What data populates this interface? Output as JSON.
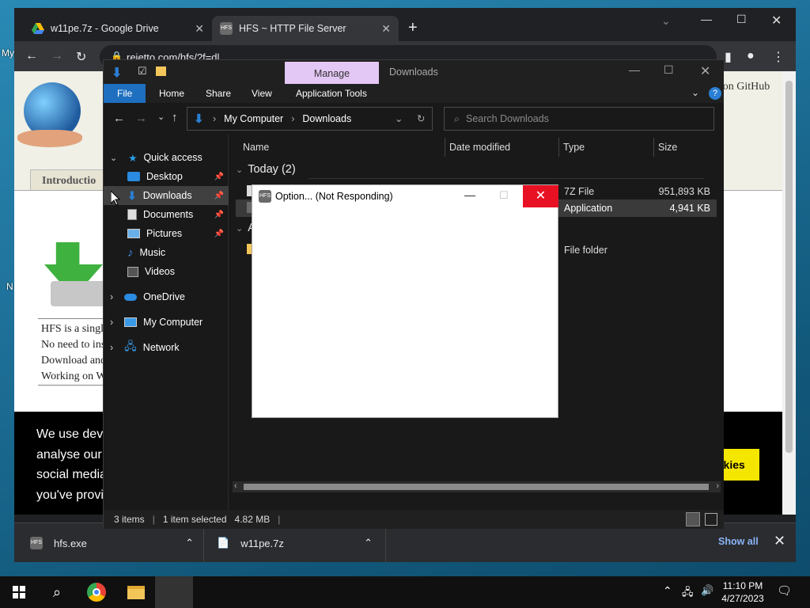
{
  "desktop": {
    "icon_labels": [
      "My",
      "N"
    ]
  },
  "chrome": {
    "tabs": [
      {
        "title": "w11pe.7z - Google Drive",
        "icon": "google-drive-icon"
      },
      {
        "title": "HFS ~ HTTP File Server",
        "icon": "hfs-icon"
      }
    ],
    "url": "rejetto.com/hfs/?f=dl",
    "webpage": {
      "github_text": "e on GitHub",
      "tab_label": "Introductio",
      "desc_lines": [
        "HFS is a singl",
        "No need to ins",
        "Download and",
        "Working on W"
      ],
      "cookie_lines": [
        "We use dev",
        "analyse our",
        "social media",
        "you've provi"
      ],
      "cookie_button": "okies"
    },
    "downloads": [
      {
        "name": "hfs.exe",
        "icon": "hfs-icon"
      },
      {
        "name": "w11pe.7z",
        "icon": "file-icon"
      }
    ],
    "show_all": "Show all"
  },
  "explorer": {
    "qat_title": "Downloads",
    "manage_label": "Manage",
    "ribbon_tabs": [
      "File",
      "Home",
      "Share",
      "View",
      "Application Tools"
    ],
    "breadcrumb": [
      "My Computer",
      "Downloads"
    ],
    "search_placeholder": "Search Downloads",
    "nav": {
      "quick_access": "Quick access",
      "items": [
        "Desktop",
        "Downloads",
        "Documents",
        "Pictures",
        "Music",
        "Videos"
      ],
      "roots": [
        "OneDrive",
        "My Computer",
        "Network"
      ]
    },
    "columns": [
      "Name",
      "Date modified",
      "Type",
      "Size"
    ],
    "group_today": "Today (2)",
    "group_a": "A",
    "files": [
      {
        "type": "7Z File",
        "size": "951,893 KB"
      },
      {
        "type": "Application",
        "size": "4,941 KB"
      },
      {
        "type": "File folder",
        "size": ""
      }
    ],
    "status": {
      "items": "3 items",
      "selected": "1 item selected",
      "size": "4.82 MB"
    }
  },
  "dialog": {
    "title": "Option... (Not Responding)"
  },
  "taskbar": {
    "time": "11:10 PM",
    "date": "4/27/2023"
  },
  "colors": {
    "accent": "#2a7fd4",
    "close_red": "#e81123",
    "manage_bg": "#e3c7f4",
    "cookie_button": "#f5e600"
  }
}
